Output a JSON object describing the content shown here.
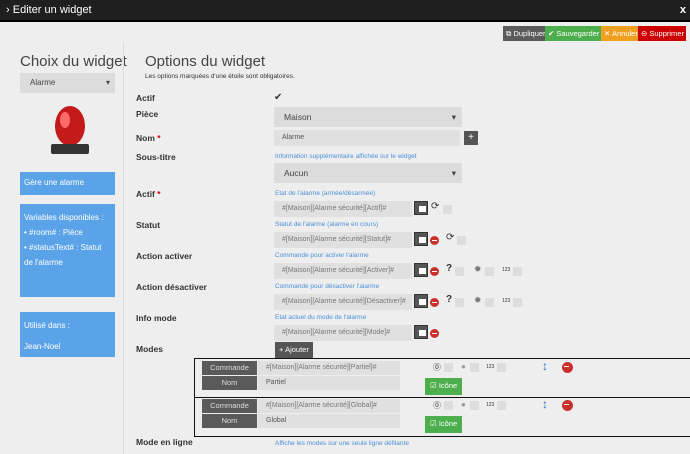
{
  "window": {
    "title": "Editer un widget",
    "close": "x"
  },
  "toolbar": {
    "duplicate": "Dupliquer",
    "save": "Sauvegarder",
    "cancel": "Annuler",
    "delete": "Supprimer",
    "colors": {
      "duplicate": "#5a5a5a",
      "save": "#4cae4c",
      "cancel": "#f0a020",
      "delete": "#cc0000"
    }
  },
  "left": {
    "title": "Choix du widget",
    "widget_select": "Alarme",
    "description": "Gère une alarme",
    "variables_title": "Variables disponibles :",
    "variables": [
      "#room# : Pièce",
      "#statusText# : Statut de l'alarme"
    ],
    "used_in_title": "Utilisé dans :",
    "used_in": "Jean-Noel"
  },
  "main": {
    "title": "Options du widget",
    "subtitle": "Les options marquées d'une étoile sont obligatoires.",
    "fields": {
      "actif": "Actif",
      "piece": "Pièce",
      "piece_value": "Maison",
      "nom": "Nom",
      "nom_value": "Alarme",
      "required": "*",
      "soustitre": "Sous-titre",
      "soustitre_help": "Information supplémentaire affichée sur le widget",
      "soustitre_value": "Aucun",
      "actif2": "Actif",
      "actif2_help": "Etat de l'alarme (armée/désarmée)",
      "actif2_value": "#[Maison][Alarme sécurité][Actif]#",
      "statut": "Statut",
      "statut_help": "Statut de l'alarme (alarme en cours)",
      "statut_value": "#[Maison][Alarme sécurité][Statut]#",
      "activer": "Action activer",
      "activer_help": "Commande pour activer l'alarme",
      "activer_value": "#[Maison][Alarme sécurité][Activer]#",
      "desactiver": "Action désactiver",
      "desactiver_help": "Commande pour désactiver l'alarme",
      "desactiver_value": "#[Maison][Alarme sécurité][Désactiver]#",
      "infomode": "Info mode",
      "infomode_help": "Etat actuel du mode de l'alarme",
      "infomode_value": "#[Maison][Alarme sécurité][Mode]#",
      "modes": "Modes",
      "add": "Ajouter",
      "modeligne": "Mode en ligne",
      "modeligne_help": "Affiche les modes sur une seule ligne défilante",
      "num": "123"
    },
    "modes": [
      {
        "commande_label": "Commande",
        "commande": "#[Maison][Alarme sécurité][Partiel]#",
        "nom_label": "Nom",
        "nom": "Partiel",
        "icon": "Icône"
      },
      {
        "commande_label": "Commande",
        "commande": "#[Maison][Alarme sécurité][Global]#",
        "nom_label": "Nom",
        "nom": "Global",
        "icon": "Icône"
      }
    ]
  }
}
